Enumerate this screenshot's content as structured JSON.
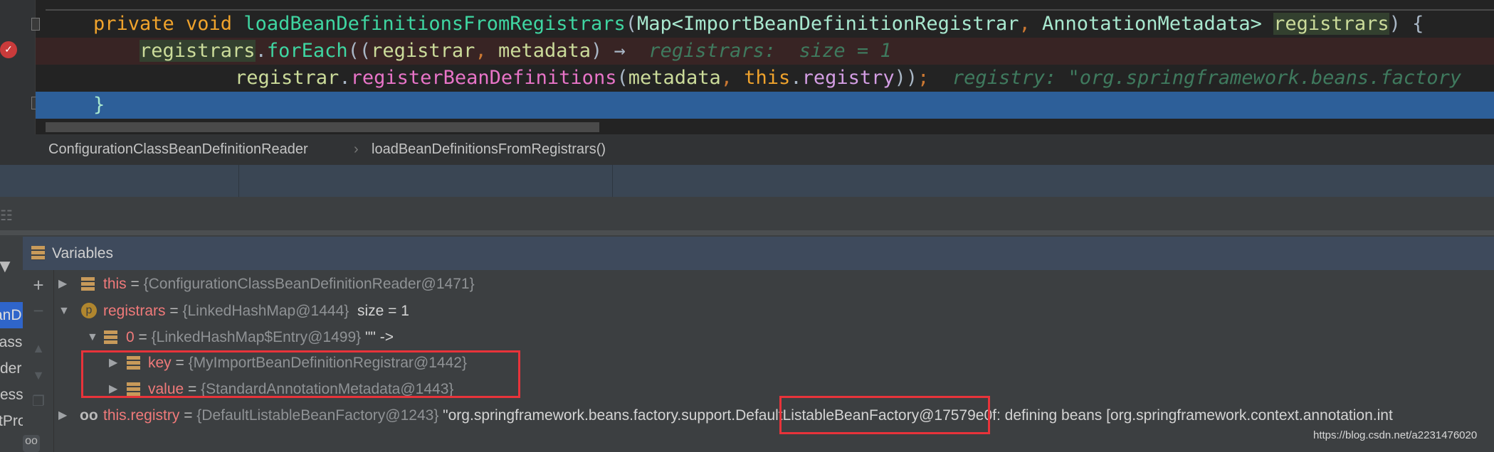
{
  "editor": {
    "lines": [
      {
        "keyword": "private void ",
        "method": "loadBeanDefinitionsFromRegistrars",
        "open": "(",
        "type1": "Map<ImportBeanDefinitionRegistrar",
        "comma": ", ",
        "type2": "AnnotationMetadata>",
        "param": "registrars",
        "close": ") {"
      },
      {
        "target": "registrars",
        "dot": ".",
        "call": "forEach",
        "open": "((",
        "p1": "registrar",
        "comma": ", ",
        "p2": "metadata",
        "arrow": ") →",
        "hint": "registrars:  size = 1"
      },
      {
        "target": "registrar",
        "dot": ".",
        "call": "registerBeanDefinitions",
        "open": "(",
        "p1": "metadata",
        "comma": ", ",
        "kw": "this",
        "dot2": ".",
        "field": "registry",
        "close": "))",
        "semi": ";",
        "hint": "registry: \"org.springframework.beans.factory"
      },
      {
        "brace": "}"
      }
    ]
  },
  "breadcrumb": {
    "items": [
      "ConfigurationClassBeanDefinitionReader",
      "loadBeanDefinitionsFromRegistrars()"
    ],
    "separator": "›"
  },
  "frames": {
    "fragments": [
      "anD",
      "lass",
      "der",
      "ess",
      "tPro"
    ]
  },
  "variables": {
    "title": "Variables",
    "rows": [
      {
        "name": "this",
        "eq": " = ",
        "value": "{ConfigurationClassBeanDefinitionReader@1471}",
        "extra": ""
      },
      {
        "name": "registrars",
        "eq": " = ",
        "value": "{LinkedHashMap@1444}",
        "extra": "  size = 1",
        "badge": "p"
      },
      {
        "name": "0",
        "eq": " = ",
        "value": "{LinkedHashMap$Entry@1499}",
        "extra": " \"\" ->"
      },
      {
        "name": "key",
        "eq": " = ",
        "value": "{MyImportBeanDefinitionRegistrar@1442}",
        "extra": ""
      },
      {
        "name": "value",
        "eq": " = ",
        "value": "{StandardAnnotationMetadata@1443}",
        "extra": ""
      },
      {
        "name": "this.registry",
        "eq": " = ",
        "value": "{DefaultListableBeanFactory@1243}",
        "extra": " \"org.springframework.beans.factory.support.DefaultListableBeanFactory@17579e0f: defining beans [org.springframework.context.annotation.int"
      }
    ]
  },
  "watermark": "https://blog.csdn.net/a2231476020",
  "colors": {
    "selection": "#2d5f99",
    "breakpoint_line": "#382424",
    "highlight_box": "#e8333a"
  }
}
